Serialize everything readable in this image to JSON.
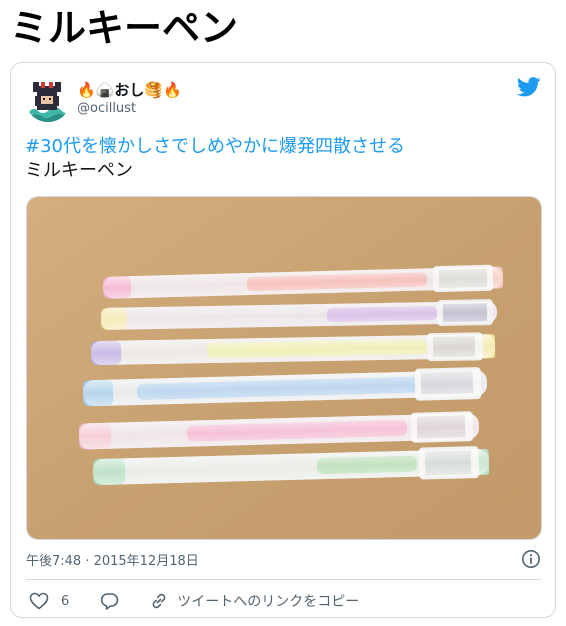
{
  "page": {
    "heading": "ミルキーペン"
  },
  "tweet": {
    "author": {
      "display_name": "🔥🍙おし🥞🔥",
      "handle": "@ocillust",
      "avatar_icon": "pixel-art-avatar"
    },
    "brand_icon": "twitter-bird-icon",
    "hashtag": "#30代を懐かしさでしめやかに爆発四散させる",
    "body": "ミルキーペン",
    "media": {
      "alt_subject": "six pastel milky gel pens"
    },
    "timestamp": "午後7:48 · 2015年12月18日",
    "actions": {
      "like_count": "6",
      "copy_link_label": "ツイートへのリンクをコピー"
    }
  },
  "colors": {
    "accent": "#1d9bf0",
    "secondary_text": "#536471",
    "border": "#cfd9de"
  }
}
